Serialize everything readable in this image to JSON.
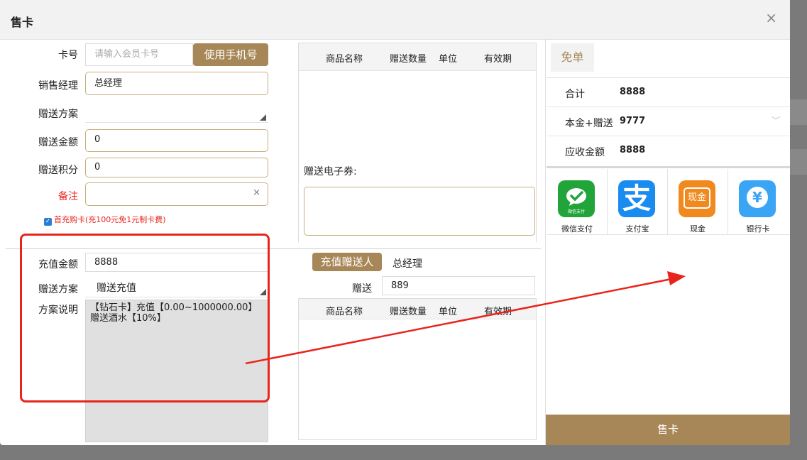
{
  "dialog": {
    "title": "售卡"
  },
  "form": {
    "card_no": {
      "label": "卡号",
      "placeholder": "请输入会员卡号",
      "button": "使用手机号"
    },
    "manager": {
      "label": "销售经理",
      "value": "总经理"
    },
    "gift_plan": {
      "label": "赠送方案",
      "value": ""
    },
    "gift_amount": {
      "label": "赠送金额",
      "value": "0"
    },
    "gift_points": {
      "label": "赠送积分",
      "value": "0"
    },
    "remark": {
      "label": "备注",
      "value": ""
    },
    "first_charge": {
      "label": "首充购卡(充100元免1元制卡费)",
      "checked": true
    }
  },
  "gift_table": {
    "headers": [
      "商品名称",
      "赠送数量",
      "单位",
      "有效期"
    ],
    "rows": []
  },
  "coupon": {
    "label": "赠送电子券:"
  },
  "recharge": {
    "amount": {
      "label": "充值金额",
      "value": "8888"
    },
    "plan": {
      "label": "赠送方案",
      "value": "赠送充值"
    },
    "desc": {
      "label": "方案说明",
      "value": "【钻石卡】充值【0.00~1000000.00】赠送酒水【10%】"
    },
    "gifter_button": "充值赠送人",
    "gifter_value": "总经理",
    "gift": {
      "label": "赠送",
      "value": "889"
    }
  },
  "gift_table2": {
    "headers": [
      "商品名称",
      "赠送数量",
      "单位",
      "有效期"
    ],
    "rows": []
  },
  "summary": {
    "free_button": "免单",
    "total": {
      "label": "合计",
      "value": "8888"
    },
    "principal_gift": {
      "label": "本金+赠送",
      "value": "9777"
    },
    "receivable": {
      "label": "应收金额",
      "value": "8888"
    }
  },
  "payments": [
    {
      "name": "wechat-pay",
      "label": "微信支付",
      "color": "#21a53a",
      "sub": "微信支付"
    },
    {
      "name": "alipay",
      "label": "支付宝",
      "color": "#1a8cf0",
      "glyph": "支"
    },
    {
      "name": "cash",
      "label": "现金",
      "color": "#f08a1e",
      "glyph": "现金"
    },
    {
      "name": "bank-card",
      "label": "银行卡",
      "color": "#3aa4f5",
      "glyph": "¥"
    }
  ],
  "submit_button": "售卡",
  "colors": {
    "gold": "#a78757",
    "annotation": "#e8251d"
  }
}
